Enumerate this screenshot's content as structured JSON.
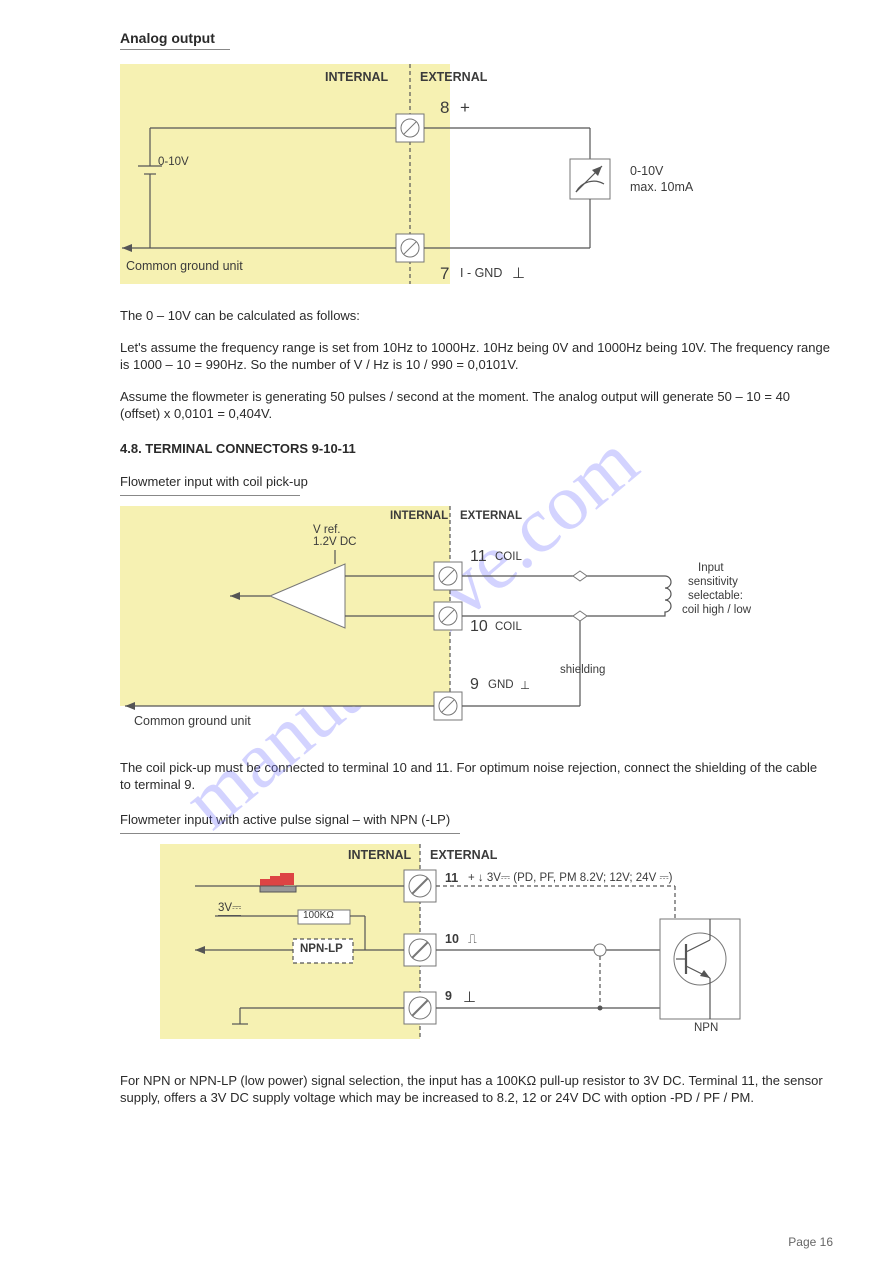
{
  "section1": {
    "title": "Analog output",
    "internal": "INTERNAL",
    "external": "EXTERNAL",
    "term8": "8",
    "term8_sign": "+",
    "term7": "7",
    "term7_label": "I - GND",
    "voltage_src": "0-10V",
    "common_ground": "Common ground unit",
    "load_spec1": "0-10V",
    "load_spec2": "max. 10mA"
  },
  "para1": "The 0 – 10V can be calculated as follows:",
  "para2": "Let's assume the frequency range is set from 10Hz to 1000Hz. 10Hz being 0V and 1000Hz being 10V. The frequency range is 1000 – 10 = 990Hz. So the number of V / Hz is 10 / 990 = 0,0101V.",
  "para3": "Assume the flowmeter is generating 50 pulses / second at the moment. The analog output will generate 50 – 10 = 40 (offset) x 0,0101 = 0,404V.",
  "section2": {
    "title": "4.8. TERMINAL CONNECTORS 9-10-11",
    "subtitle": "Flowmeter input with coil pick-up",
    "internal": "INTERNAL",
    "external": "EXTERNAL",
    "vref": "V ref.\n1.2V DC",
    "term11": "11",
    "term11_label": "COIL",
    "term10": "10",
    "term10_label": "COIL",
    "term9": "9",
    "term9_label": "GND",
    "shielding": "shielding",
    "common_ground": "Common ground unit",
    "notes1": "Input",
    "notes2": "sensitivity",
    "notes3": "selectable:",
    "notes4": "coil high / low"
  },
  "para4": "The coil pick-up must be connected to terminal 10 and 11. For optimum noise rejection, connect the shielding of the cable to terminal 9.",
  "section3": {
    "title": "Flowmeter input with active pulse signal – with NPN (-LP)",
    "internal": "INTERNAL",
    "external": "EXTERNAL",
    "term11": "11",
    "term11_extra": "+ ↓ 3V⎓ (PD, PF, PM 8.2V; 12V; 24V ⎓)",
    "volt3v": "3V⎓",
    "res": "100KΩ",
    "npnlp": "NPN-LP",
    "term10": "10",
    "term9": "9",
    "npn": "NPN"
  },
  "para5": "For NPN or NPN-LP (low power) signal selection, the input has a 100KΩ pull-up resistor to 3V DC. Terminal 11, the sensor supply, offers a 3V DC supply voltage which may be increased to 8.2, 12 or 24V DC with option -PD / PF / PM.",
  "pagenum": "Page 16"
}
